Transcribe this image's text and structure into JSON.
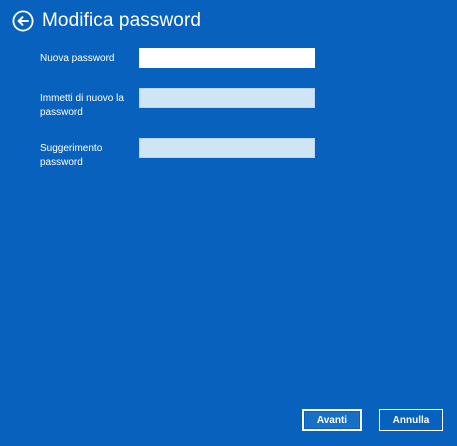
{
  "window": {
    "title": "Modifica password",
    "back_icon": "back-arrow-circle-icon"
  },
  "form": {
    "new_password": {
      "label": "Nuova password",
      "value": "",
      "placeholder": ""
    },
    "confirm_password": {
      "label": "Immetti di nuovo la password",
      "value": "",
      "placeholder": ""
    },
    "hint": {
      "label": "Suggerimento password",
      "value": "",
      "placeholder": ""
    }
  },
  "buttons": {
    "next_label": "Avanti",
    "cancel_label": "Annulla"
  },
  "colors": {
    "background": "#0862bd",
    "text": "#ffffff",
    "input_active": "#ffffff",
    "input_inactive": "#cfe4f5"
  }
}
